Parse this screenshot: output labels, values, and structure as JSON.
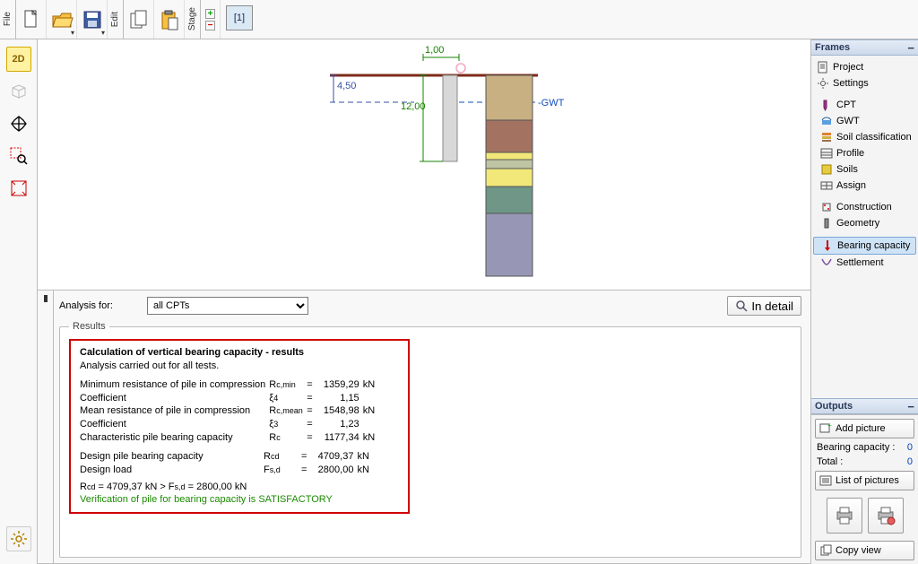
{
  "toolbar": {
    "file_label": "File",
    "edit_label": "Edit",
    "stage_label": "Stage",
    "tab1": "[1]"
  },
  "left_tools": {
    "view2d": "2D",
    "view3d": "3D"
  },
  "canvas": {
    "dim_top": "1,00",
    "dim_left": "4,50",
    "dim_inner": "12,00",
    "gwt_label": "-GWT"
  },
  "analysis": {
    "for_label": "Analysis for:",
    "dropdown": "all CPTs",
    "in_detail": "In detail",
    "results_legend": "Results",
    "title": "Calculation of vertical bearing capacity - results",
    "subtitle": "Analysis carried out for all tests.",
    "row1_label": "Minimum resistance of pile in compression",
    "row1_sym": "R",
    "row1_sub": "c,min",
    "row1_val": "1359,29",
    "row1_unit": "kN",
    "row2_label": "Coefficient",
    "row2_sym": "ξ",
    "row2_sub": "4",
    "row2_val": "1,15",
    "row2_unit": "",
    "row3_label": "Mean resistance of pile in compression",
    "row3_sym": "R",
    "row3_sub": "c,mean",
    "row3_val": "1548,98",
    "row3_unit": "kN",
    "row4_label": "Coefficient",
    "row4_sym": "ξ",
    "row4_sub": "3",
    "row4_val": "1,23",
    "row4_unit": "",
    "row5_label": "Characteristic pile bearing capacity",
    "row5_sym": "R",
    "row5_sub": "c",
    "row5_val": "1177,34",
    "row5_unit": "kN",
    "row6_label": "Design pile bearing capacity",
    "row6_sym": "R",
    "row6_sub": "cd",
    "row6_val": "4709,37",
    "row6_unit": "kN",
    "row7_label": "Design load",
    "row7_sym": "F",
    "row7_sub": "s,d",
    "row7_val": "2800,00",
    "row7_unit": "kN",
    "compare": "Rcd = 4709,37 kN > Fs,d = 2800,00 kN",
    "satisfactory": "Verification of pile for bearing capacity is SATISFACTORY",
    "side_label": "Bearing capacity"
  },
  "frames": {
    "title": "Frames",
    "items": [
      {
        "label": "Project"
      },
      {
        "label": "Settings"
      },
      {
        "label": "CPT"
      },
      {
        "label": "GWT"
      },
      {
        "label": "Soil classification"
      },
      {
        "label": "Profile"
      },
      {
        "label": "Soils"
      },
      {
        "label": "Assign"
      },
      {
        "label": "Construction"
      },
      {
        "label": "Geometry"
      },
      {
        "label": "Bearing capacity"
      },
      {
        "label": "Settlement"
      }
    ]
  },
  "outputs": {
    "title": "Outputs",
    "add_picture": "Add picture",
    "bearing_label": "Bearing capacity :",
    "bearing_val": "0",
    "total_label": "Total :",
    "total_val": "0",
    "list_pictures": "List of pictures",
    "copy_view": "Copy view"
  }
}
